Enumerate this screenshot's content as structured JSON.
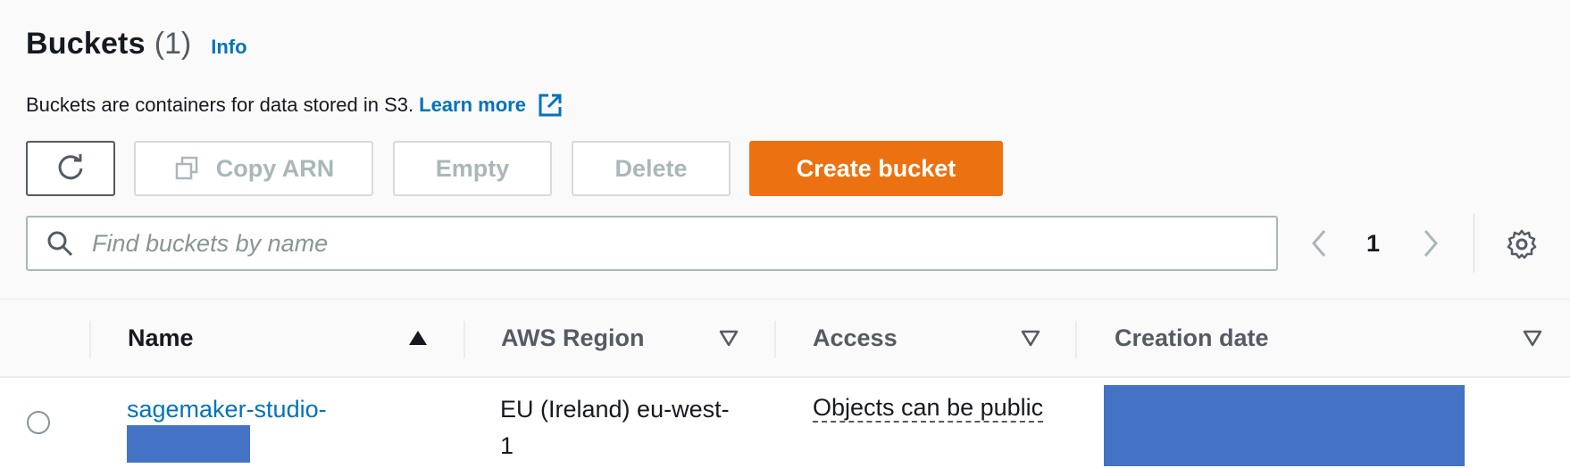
{
  "header": {
    "title": "Buckets",
    "count": "(1)",
    "info_link": "Info",
    "description": "Buckets are containers for data stored in S3.",
    "learn_more": "Learn more"
  },
  "toolbar": {
    "refresh_icon": "refresh-icon",
    "copy_arn_label": "Copy ARN",
    "empty_label": "Empty",
    "delete_label": "Delete",
    "create_label": "Create bucket"
  },
  "search": {
    "placeholder": "Find buckets by name",
    "value": ""
  },
  "pagination": {
    "current_page": "1"
  },
  "table": {
    "columns": [
      {
        "label": "Name",
        "sort": "ascending"
      },
      {
        "label": "AWS Region",
        "sort": "none"
      },
      {
        "label": "Access",
        "sort": "none"
      },
      {
        "label": "Creation date",
        "sort": "none"
      }
    ],
    "rows": [
      {
        "name_visible": "sagemaker-studio-",
        "region": "EU (Ireland) eu-west-1",
        "access": "Objects can be public"
      }
    ]
  },
  "colors": {
    "link": "#0073bb",
    "primary_button": "#ec7211",
    "redaction": "#4472c4",
    "disabled_text": "#aab7b8"
  }
}
